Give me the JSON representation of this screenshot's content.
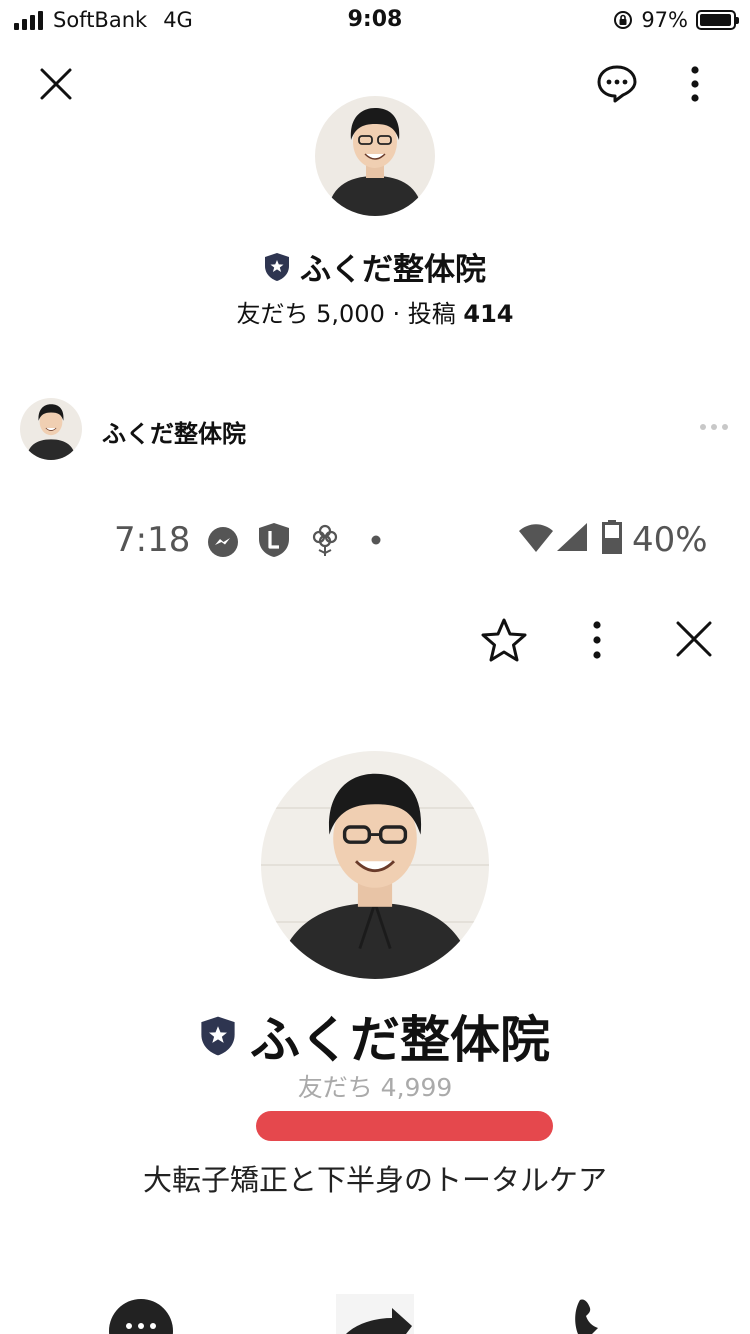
{
  "status_bar": {
    "carrier": "SoftBank",
    "network": "4G",
    "time": "9:08",
    "battery_pct": "97%",
    "battery_level": 0.97
  },
  "header": {
    "close_icon": "close-icon",
    "chat_icon": "chat-bubble-icon",
    "more_icon": "more-vertical-icon"
  },
  "profile": {
    "name": "ふくだ整体院",
    "friends_label": "友だち",
    "friends_count": "5,000",
    "separator": "·",
    "posts_label": "投稿",
    "posts_count": "414",
    "badge_color": "#2e3550"
  },
  "post": {
    "author": "ふくだ整体院"
  },
  "embedded_screenshot": {
    "status_time": "7:18",
    "battery_pct": "40%",
    "name": "ふくだ整体院",
    "friends": "友だち 4,999",
    "tagline": "大転子矯正と下半身のトータルケア",
    "redaction_color": "#e5484d"
  }
}
